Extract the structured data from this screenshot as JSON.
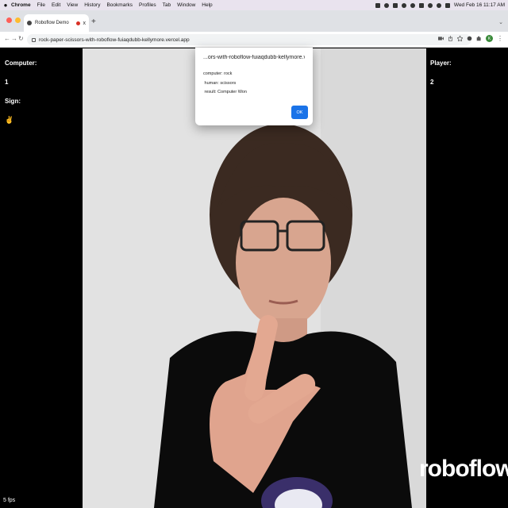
{
  "menubar": {
    "items": [
      "Chrome",
      "File",
      "Edit",
      "View",
      "History",
      "Bookmarks",
      "Profiles",
      "Tab",
      "Window",
      "Help"
    ],
    "clock": "Wed Feb 16  11:17 AM"
  },
  "browser": {
    "tab_title": "Roboflow Demo",
    "tab_close": "x",
    "new_tab": "+",
    "url": "rock-paper-scissors-with-roboflow-fuiaqdubb-kellymore.vercel.app",
    "avatar_letter": "K",
    "traffic_colors": [
      "#ff5f57",
      "#febc2e",
      "#28c840"
    ]
  },
  "game": {
    "computer_label": "Computer:",
    "computer_score": "1",
    "sign_label": "Sign:",
    "sign_emoji": "✌",
    "player_label": "Player:",
    "player_score": "2",
    "fps": "5 fps",
    "brand": "roboflow"
  },
  "dialog": {
    "title": "...ors-with-roboflow-fuiaqdubb-kellymore.vercel.app says",
    "lines": [
      "computer: rock",
      " human: scissors",
      " result: Computer Won"
    ],
    "ok_label": "OK"
  },
  "colors": {
    "accent": "#1a73e8",
    "page_bg": "#000000",
    "wall": "#e2e2e2",
    "shirt": "#0b0b0b"
  }
}
